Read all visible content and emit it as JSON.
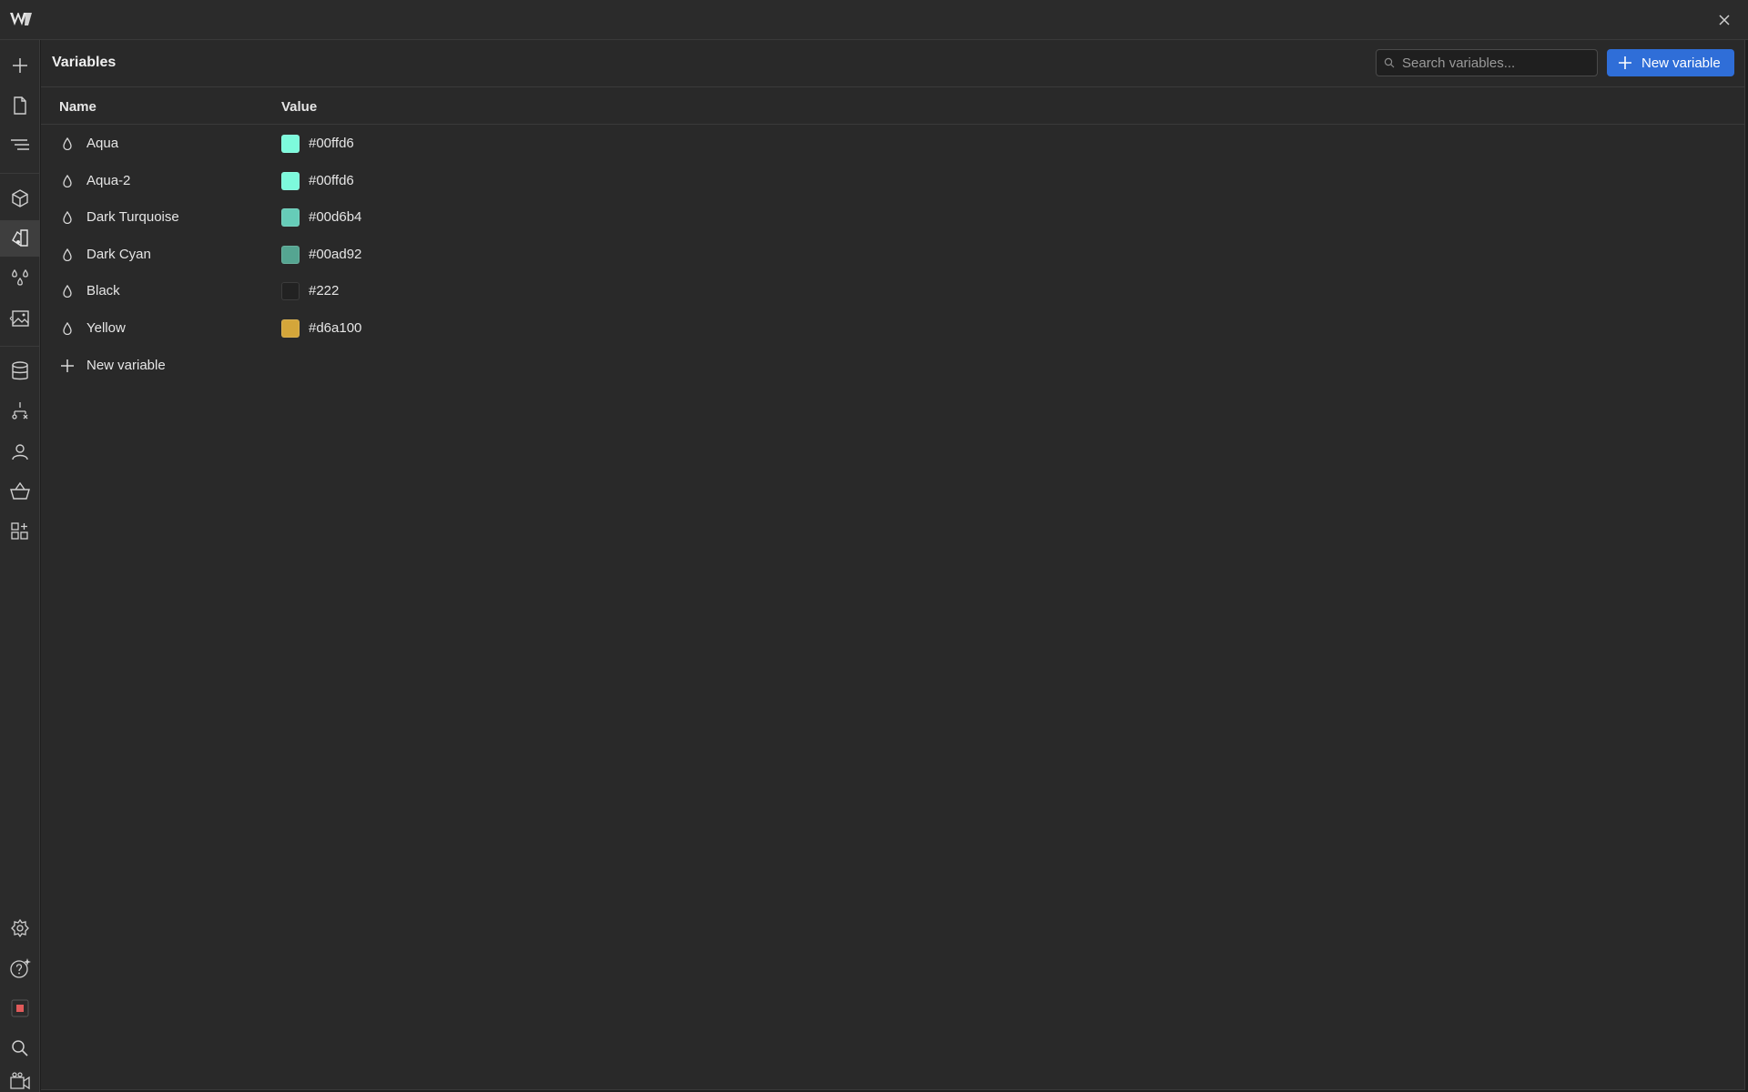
{
  "topbar": {
    "logo_icon": "webflow-logo-icon",
    "close_icon": "close-icon"
  },
  "sidebar": {
    "top_icons": [
      {
        "name": "add-icon"
      },
      {
        "name": "page-icon"
      },
      {
        "name": "navigator-icon"
      },
      {
        "name": "components-icon"
      },
      {
        "name": "style-selector-icon",
        "active": true
      },
      {
        "name": "variables-icon"
      },
      {
        "name": "assets-icon"
      },
      {
        "name": "cms-icon"
      },
      {
        "name": "logic-icon"
      },
      {
        "name": "users-icon"
      },
      {
        "name": "ecommerce-icon"
      },
      {
        "name": "apps-icon"
      }
    ],
    "bottom_icons": [
      {
        "name": "settings-icon"
      },
      {
        "name": "help-icon"
      },
      {
        "name": "record-icon"
      },
      {
        "name": "search-icon"
      },
      {
        "name": "video-icon"
      }
    ]
  },
  "panel": {
    "title": "Variables",
    "search": {
      "placeholder": "Search variables...",
      "value": ""
    },
    "new_variable_button": "New variable",
    "columns": {
      "name": "Name",
      "value": "Value"
    },
    "variables": [
      {
        "name": "Aqua",
        "hex": "#00ffd6",
        "swatch": "#7dfadc"
      },
      {
        "name": "Aqua-2",
        "hex": "#00ffd6",
        "swatch": "#7dfadc"
      },
      {
        "name": "Dark Turquoise",
        "hex": "#00d6b4",
        "swatch": "#66ccb8"
      },
      {
        "name": "Dark Cyan",
        "hex": "#00ad92",
        "swatch": "#55a591"
      },
      {
        "name": "Black",
        "hex": "#222",
        "swatch": "#222222"
      },
      {
        "name": "Yellow",
        "hex": "#d6a100",
        "swatch": "#d4a63a"
      }
    ],
    "add_row_label": "New variable"
  },
  "colors": {
    "accent": "#2f6ed8",
    "background": "#292929",
    "chrome": "#2b2b2b"
  }
}
